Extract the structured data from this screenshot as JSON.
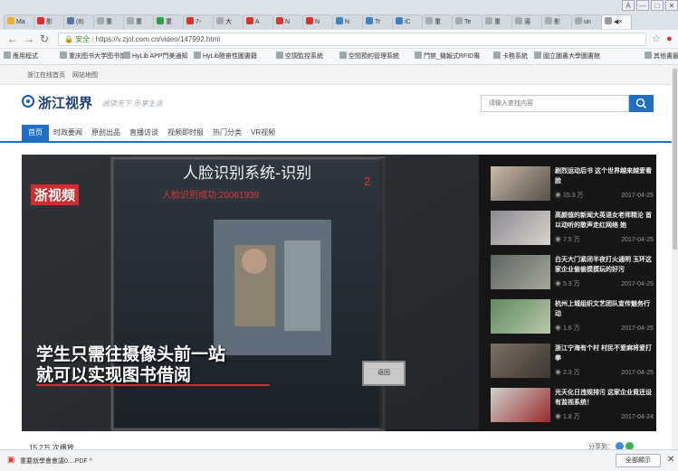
{
  "browser": {
    "tabs": [
      {
        "label": "Ma",
        "color": "#f2b124"
      },
      {
        "label": "影",
        "color": "#e02b2b"
      },
      {
        "label": "(8)",
        "color": "#5577aa"
      },
      {
        "label": "重",
        "color": "#aaaaaa"
      },
      {
        "label": "重",
        "color": "#aaaaaa"
      },
      {
        "label": "重",
        "color": "#2f9e44"
      },
      {
        "label": "7-",
        "color": "#d9342b"
      },
      {
        "label": "大",
        "color": "#aaaaaa"
      },
      {
        "label": "A",
        "color": "#d9342b"
      },
      {
        "label": "N",
        "color": "#d9342b"
      },
      {
        "label": "N",
        "color": "#d9342b"
      },
      {
        "label": "N",
        "color": "#3b82c4"
      },
      {
        "label": "Tr",
        "color": "#3b82c4"
      },
      {
        "label": "iC",
        "color": "#3b82c4"
      },
      {
        "label": "重",
        "color": "#aaaaaa"
      },
      {
        "label": "Te",
        "color": "#aaaaaa"
      },
      {
        "label": "重",
        "color": "#aaaaaa"
      },
      {
        "label": "湯",
        "color": "#aaaaaa"
      },
      {
        "label": "影",
        "color": "#aaaaaa"
      },
      {
        "label": "un",
        "color": "#aaaaaa"
      },
      {
        "label": "◀×",
        "color": "#999999"
      }
    ],
    "window_buttons": [
      "A",
      "—",
      "□",
      "✕"
    ],
    "secure_label": "安全",
    "url": "https://v.zjol.com.cn/video/147992.html",
    "bookmarks": [
      "應用程式",
      "重庆图书大学图书馆",
      "HyLib APP門美通知",
      "HyLib館奋性圖書籍",
      "空調監控系統",
      "空間預約管理系統",
      "門禁_機報式RFID電",
      "卡務系統",
      "國立圖書大學圖書館",
      "其他書籤"
    ]
  },
  "site": {
    "top_links": [
      "浙江在线首页",
      "网站地图"
    ],
    "logo": "浙江视界",
    "slogan": "阅读天下 乐享生活",
    "search_placeholder": "请输入查找内容",
    "nav": [
      "首页",
      "时政要闻",
      "原创出品",
      "直播访谈",
      "视频即时报",
      "热门分类",
      "VR视频"
    ]
  },
  "video": {
    "screen_title": "人脸识别系统-识别",
    "screen_sub": "人脸识别成功:20061939",
    "screen_num": "2",
    "badge": "浙视频",
    "caption_line1": "学生只需往摄像头前一站",
    "caption_line2": "就可以实现图书借阅",
    "button": "返回",
    "view_count": "15.2万 次播放",
    "share": "分享到："
  },
  "sidebar": [
    {
      "title": "剧烈运动后书 这个世界越来越爱看脸",
      "views": "15.3 万",
      "date": "2017-04-25"
    },
    {
      "title": "高颜值的新闻大英语女老师精沦 首以动听的歌声走红网络 她",
      "views": "7.5 万",
      "date": "2017-04-25"
    },
    {
      "title": "白天大门紧闭半夜打火通明 玉环这家企业偷偷摸摸玩的好污",
      "views": "5.3 万",
      "date": "2017-04-25"
    },
    {
      "title": "杭州上城组织文艺团队宣传魅务行动",
      "views": "1.6 万",
      "date": "2017-04-25"
    },
    {
      "title": "浙江宁海有个村 村民不爱麻将爱打拳",
      "views": "2.3 万",
      "date": "2017-04-25"
    },
    {
      "title": "光天化日违规排污 这家企业竟还设有监视系统！",
      "views": "1.8 万",
      "date": "2017-04-24"
    }
  ],
  "downloads": {
    "file": "重要就學會會議0....PDF",
    "show_all": "全部顯示"
  },
  "colors": {
    "brand": "#1f6fc5",
    "logo": "#1b3f73",
    "caption": "#ffffff"
  }
}
